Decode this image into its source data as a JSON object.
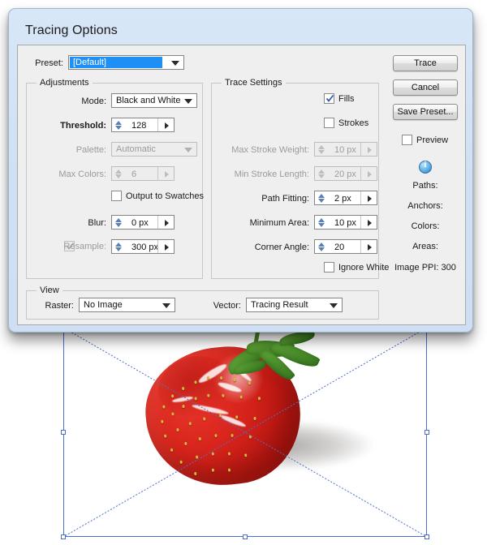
{
  "dialog": {
    "title": "Tracing Options",
    "preset": {
      "label": "Preset:",
      "value": "[Default]"
    },
    "adjustments": {
      "group_title": "Adjustments",
      "mode": {
        "label": "Mode:",
        "value": "Black and White"
      },
      "threshold": {
        "label": "Threshold:",
        "value": "128"
      },
      "palette": {
        "label": "Palette:",
        "value": "Automatic"
      },
      "max_colors": {
        "label": "Max Colors:",
        "value": "6"
      },
      "output_to_swatches": {
        "label": "Output to Swatches",
        "checked": false
      },
      "blur": {
        "label": "Blur:",
        "value": "0 px"
      },
      "resample": {
        "label": "Resample:",
        "value": "300 px",
        "checked": true
      }
    },
    "trace_settings": {
      "group_title": "Trace Settings",
      "fills": {
        "label": "Fills",
        "checked": true
      },
      "strokes": {
        "label": "Strokes",
        "checked": false
      },
      "max_stroke_weight": {
        "label": "Max Stroke Weight:",
        "value": "10 px"
      },
      "min_stroke_length": {
        "label": "Min Stroke Length:",
        "value": "20 px"
      },
      "path_fitting": {
        "label": "Path Fitting:",
        "value": "2 px"
      },
      "minimum_area": {
        "label": "Minimum Area:",
        "value": "10 px"
      },
      "corner_angle": {
        "label": "Corner Angle:",
        "value": "20"
      },
      "ignore_white": {
        "label": "Ignore White",
        "checked": false
      }
    },
    "view": {
      "group_title": "View",
      "raster": {
        "label": "Raster:",
        "value": "No Image"
      },
      "vector": {
        "label": "Vector:",
        "value": "Tracing Result"
      }
    },
    "buttons": {
      "trace": "Trace",
      "cancel": "Cancel",
      "save_preset": "Save Preset..."
    },
    "preview": {
      "label": "Preview",
      "checked": false
    },
    "info_icon": "info-icon",
    "stats": {
      "paths": "Paths:",
      "anchors": "Anchors:",
      "colors": "Colors:",
      "areas": "Areas:",
      "image_ppi": "Image PPI: 300"
    }
  },
  "artwork": {
    "subject": "strawberry",
    "selection": "selected-object-bounding-box"
  },
  "colors": {
    "accent_blue": "#1e90f5",
    "selection_blue": "#4a6fd0",
    "dialog_frame": "#cfe0f4",
    "panel_bg": "#efefef",
    "berry_red": "#cf2019",
    "leaf_green": "#4c8f2c"
  }
}
